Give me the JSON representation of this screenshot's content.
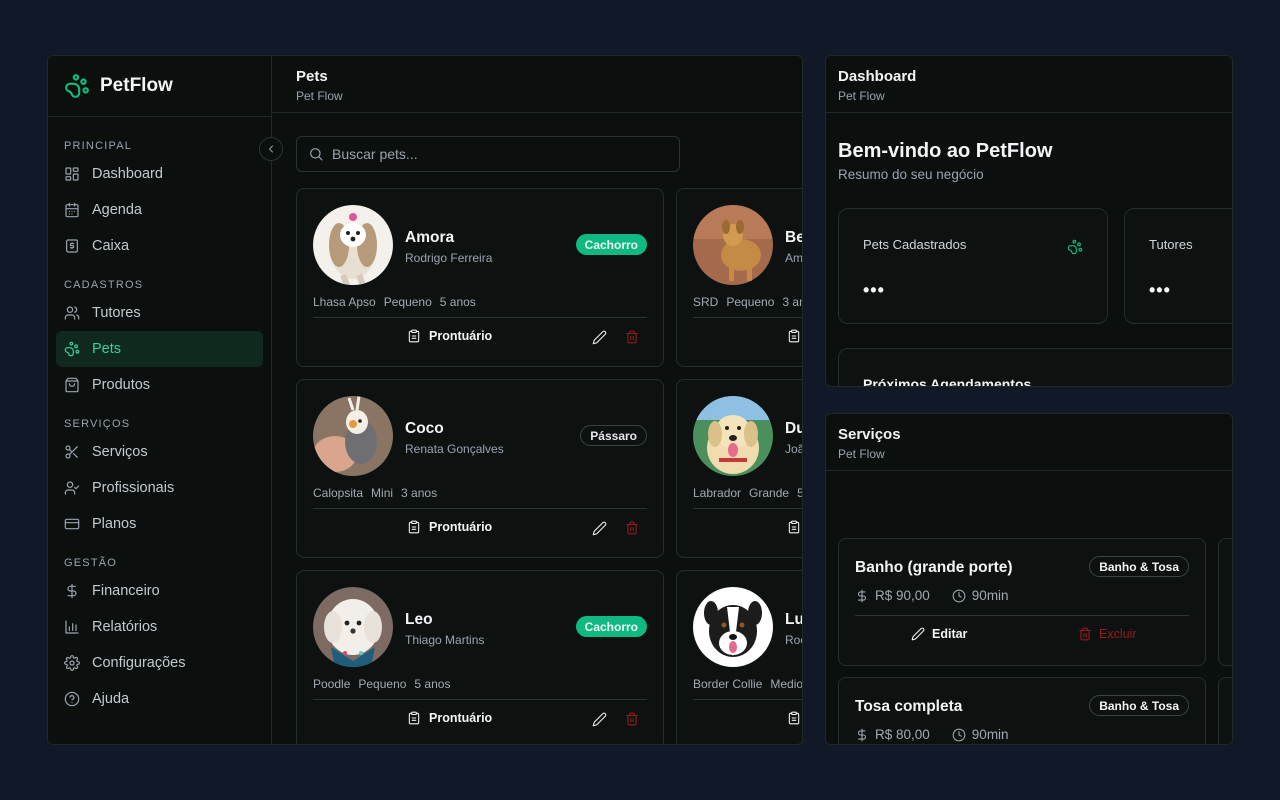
{
  "app": {
    "name": "PetFlow"
  },
  "sidebar": {
    "sections": [
      {
        "title": "PRINCIPAL",
        "items": [
          {
            "label": "Dashboard",
            "icon": "layout-dashboard-icon"
          },
          {
            "label": "Agenda",
            "icon": "calendar-icon"
          },
          {
            "label": "Caixa",
            "icon": "cash-register-icon"
          }
        ]
      },
      {
        "title": "CADASTROS",
        "items": [
          {
            "label": "Tutores",
            "icon": "users-icon"
          },
          {
            "label": "Pets",
            "icon": "paw-icon",
            "active": true
          },
          {
            "label": "Produtos",
            "icon": "shopping-bag-icon"
          }
        ]
      },
      {
        "title": "SERVIÇOS",
        "items": [
          {
            "label": "Serviços",
            "icon": "scissors-icon"
          },
          {
            "label": "Profissionais",
            "icon": "user-check-icon"
          },
          {
            "label": "Planos",
            "icon": "credit-card-icon"
          }
        ]
      },
      {
        "title": "GESTÃO",
        "items": [
          {
            "label": "Financeiro",
            "icon": "dollar-icon"
          },
          {
            "label": "Relatórios",
            "icon": "bar-chart-icon"
          },
          {
            "label": "Configurações",
            "icon": "settings-icon"
          },
          {
            "label": "Ajuda",
            "icon": "help-circle-icon"
          }
        ]
      }
    ]
  },
  "pets_page": {
    "title": "Pets",
    "subtitle": "Pet Flow",
    "search_placeholder": "Buscar pets...",
    "record_label": "Prontuário",
    "pets": [
      {
        "name": "Amora",
        "owner": "Rodrigo Ferreira",
        "species": "Cachorro",
        "breed": "Lhasa Apso",
        "size": "Pequeno",
        "age": "5 anos"
      },
      {
        "name": "Be",
        "owner": "Am",
        "breed": "SRD",
        "size": "Pequeno",
        "age": "3 an"
      },
      {
        "name": "Coco",
        "owner": "Renata Gonçalves",
        "species": "Pássaro",
        "breed": "Calopsita",
        "size": "Mini",
        "age": "3 anos"
      },
      {
        "name": "Du",
        "owner": "Joã",
        "breed": "Labrador",
        "size": "Grande",
        "age": "5"
      },
      {
        "name": "Leo",
        "owner": "Thiago Martins",
        "species": "Cachorro",
        "breed": "Poodle",
        "size": "Pequeno",
        "age": "5 anos"
      },
      {
        "name": "Lu",
        "owner": "Roc",
        "breed": "Border Collie",
        "size": "Medio",
        "age": ""
      }
    ]
  },
  "dashboard": {
    "title": "Dashboard",
    "subtitle": "Pet Flow",
    "welcome": "Bem-vindo ao PetFlow",
    "welcome_sub": "Resumo do seu negócio",
    "stats": [
      {
        "label": "Pets Cadastrados",
        "value": "•••"
      },
      {
        "label": "Tutores",
        "value": "•••"
      }
    ],
    "upcoming_title": "Próximos Agendamentos"
  },
  "services": {
    "title": "Serviços",
    "subtitle": "Pet Flow",
    "edit_label": "Editar",
    "delete_label": "Excluir",
    "items": [
      {
        "name": "Banho (grande porte)",
        "category": "Banho & Tosa",
        "price": "R$ 90,00",
        "duration": "90min"
      },
      {
        "name": "Tosa completa",
        "category": "Banho & Tosa",
        "price": "R$ 80,00",
        "duration": "90min"
      }
    ]
  },
  "colors": {
    "accent": "#10b981",
    "danger": "#991b1b",
    "background": "#111827",
    "panel": "#0b0f0e"
  }
}
